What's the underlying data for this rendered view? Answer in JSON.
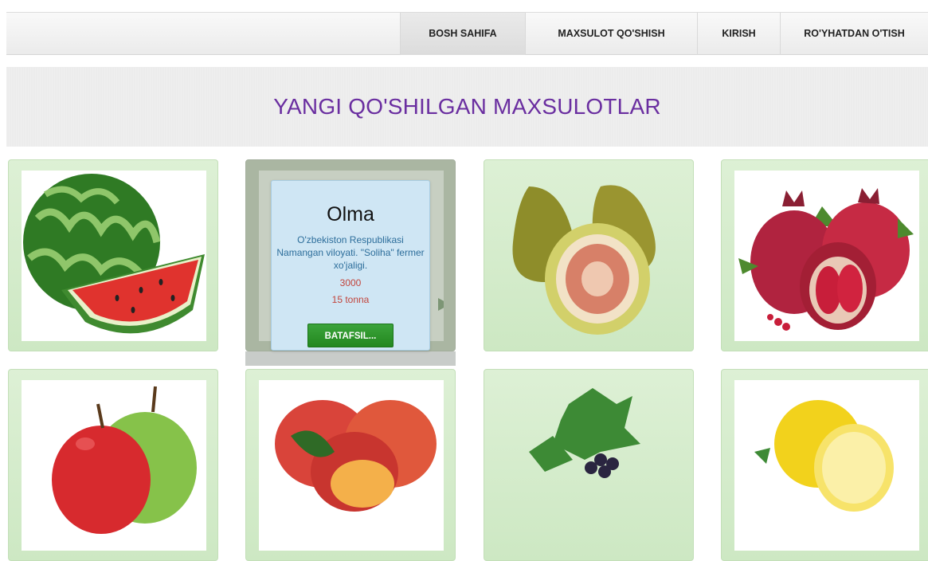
{
  "nav": {
    "items": [
      {
        "label": "BOSH SAHIFA",
        "active": true
      },
      {
        "label": "MAXSULOT QO'SHISH",
        "active": false
      },
      {
        "label": "KIRISH",
        "active": false
      },
      {
        "label": "RO'YHATDAN O'TISH",
        "active": false
      }
    ]
  },
  "hero": {
    "title": "YANGI QO'SHILGAN MAXSULOTLAR"
  },
  "products": [
    {
      "image": "watermelon"
    },
    {
      "image": "melon",
      "hovered": true
    },
    {
      "image": "fig"
    },
    {
      "image": "pomegranate"
    },
    {
      "image": "apples"
    },
    {
      "image": "peach"
    },
    {
      "image": "grapes"
    },
    {
      "image": "lemon"
    }
  ],
  "popup": {
    "title": "Olma",
    "description": "O'zbekiston Respublikasi Namangan viloyati. \"Soliha\" fermer xo'jaligi.",
    "price": "3000",
    "quantity": "15 tonna",
    "button": "BATAFSIL..."
  },
  "colors": {
    "title": "#6a2ea0",
    "card_bg": "#d5ecca",
    "popup_bg": "#cfe6f4",
    "popup_text": "#2d6e9b",
    "price": "#c2453c",
    "button": "#2c962a"
  }
}
